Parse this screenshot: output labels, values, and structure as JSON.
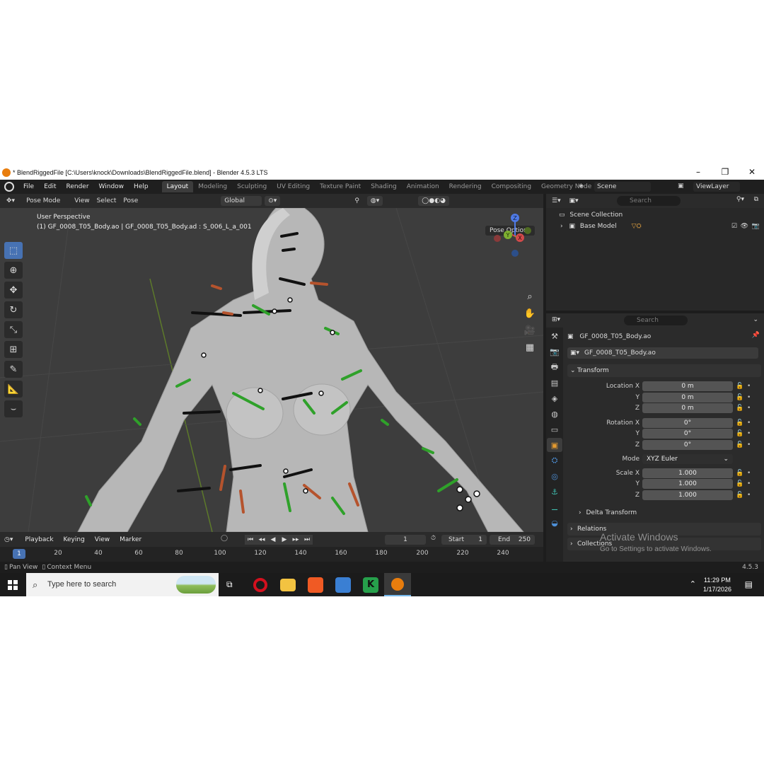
{
  "window": {
    "title": "* BlendRiggedFile [C:\\Users\\knock\\Downloads\\BlendRiggedFile.blend] - Blender 4.5.3 LTS"
  },
  "menu": [
    "File",
    "Edit",
    "Render",
    "Window",
    "Help"
  ],
  "workspaces": [
    "Layout",
    "Modeling",
    "Sculpting",
    "UV Editing",
    "Texture Paint",
    "Shading",
    "Animation",
    "Rendering",
    "Compositing",
    "Geometry Node"
  ],
  "scene": {
    "label": "Scene",
    "view_layer": "ViewLayer"
  },
  "viewport": {
    "mode": "Pose Mode",
    "menus": [
      "View",
      "Select",
      "Pose"
    ],
    "orientation": "Global",
    "pose_options": "Pose Options",
    "perspective": "User Perspective",
    "active_info": "(1) GF_0008_T05_Body.ao | GF_0008_T05_Body.ad : S_006_L_a_001",
    "gizmo_axes": [
      "Z",
      "Y",
      "X"
    ],
    "colors": {
      "bg": "#3d3d3d",
      "bone_green": "#2fa12a",
      "bone_red": "#b5532d",
      "bone_black": "#111111"
    }
  },
  "timeline": {
    "menus": [
      "Playback",
      "Keying",
      "View",
      "Marker"
    ],
    "current_frame": "1",
    "start_label": "Start",
    "start": "1",
    "end_label": "End",
    "end": "250",
    "frame_indicator": "1",
    "ticks": [
      "20",
      "40",
      "60",
      "80",
      "100",
      "120",
      "140",
      "160",
      "180",
      "200",
      "220",
      "240"
    ]
  },
  "statusbar": {
    "left1": "Pan View",
    "left2": "Context Menu",
    "version": "4.5.3"
  },
  "outliner": {
    "search_placeholder": "Search",
    "scene_collection": "Scene Collection",
    "items": [
      "Base Model"
    ]
  },
  "properties": {
    "search_placeholder": "Search",
    "object_name": "GF_0008_T05_Body.ao",
    "data_name": "GF_0008_T05_Body.ao",
    "transform_header": "Transform",
    "location_label": "Location X",
    "location": [
      "0 m",
      "0 m",
      "0 m"
    ],
    "rotation_label": "Rotation X",
    "rotation": [
      "0°",
      "0°",
      "0°"
    ],
    "mode_label": "Mode",
    "mode_value": "XYZ Euler",
    "scale_label": "Scale X",
    "scale": [
      "1.000",
      "1.000",
      "1.000"
    ],
    "axis_y": "Y",
    "axis_z": "Z",
    "delta_transform": "Delta Transform",
    "relations": "Relations",
    "collections": "Collections"
  },
  "watermark": {
    "line1": "Activate Windows",
    "line2": "Go to Settings to activate Windows."
  },
  "taskbar": {
    "search_placeholder": "Type here to search",
    "time": "11:29 PM",
    "date": "1/17/2026"
  }
}
